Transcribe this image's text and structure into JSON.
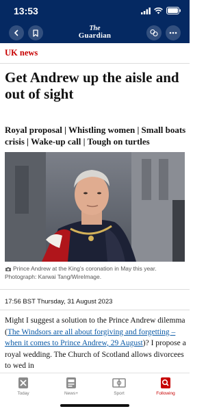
{
  "status_bar": {
    "time": "13:53"
  },
  "header": {
    "logo_line1": "The",
    "logo_line2": "Guardian",
    "brand_color": "#052962"
  },
  "section_label": "UK news",
  "headline": "Get Andrew up the aisle and out of sight",
  "standfirst": "Royal proposal | Whistling women | Small boats crisis | Wake-up call | Tough on turtles",
  "image_caption": "Prince Andrew at the King’s coronation in May this year. Photograph: Karwai Tang/WireImage.",
  "dateline": "17:56 BST Thursday, 31 August 2023",
  "body": {
    "intro": "Might I suggest a solution to the Prince Andrew dilemma (",
    "link": "The Windsors are all about forgiving and forgetting – when it comes to Prince Andrew, 29 August",
    "rest": ")? I propose a royal wedding. The Church of Scotland allows divorcees to wed in"
  },
  "tab_bar": {
    "tabs": [
      {
        "label": "Today",
        "icon": "today-icon",
        "active": false
      },
      {
        "label": "News+",
        "icon": "news-plus-icon",
        "active": false
      },
      {
        "label": "Sport",
        "icon": "sport-icon",
        "active": false
      },
      {
        "label": "Following",
        "icon": "following-icon",
        "active": true
      }
    ]
  },
  "colors": {
    "accent": "#c70000",
    "link": "#0b5aa6"
  }
}
